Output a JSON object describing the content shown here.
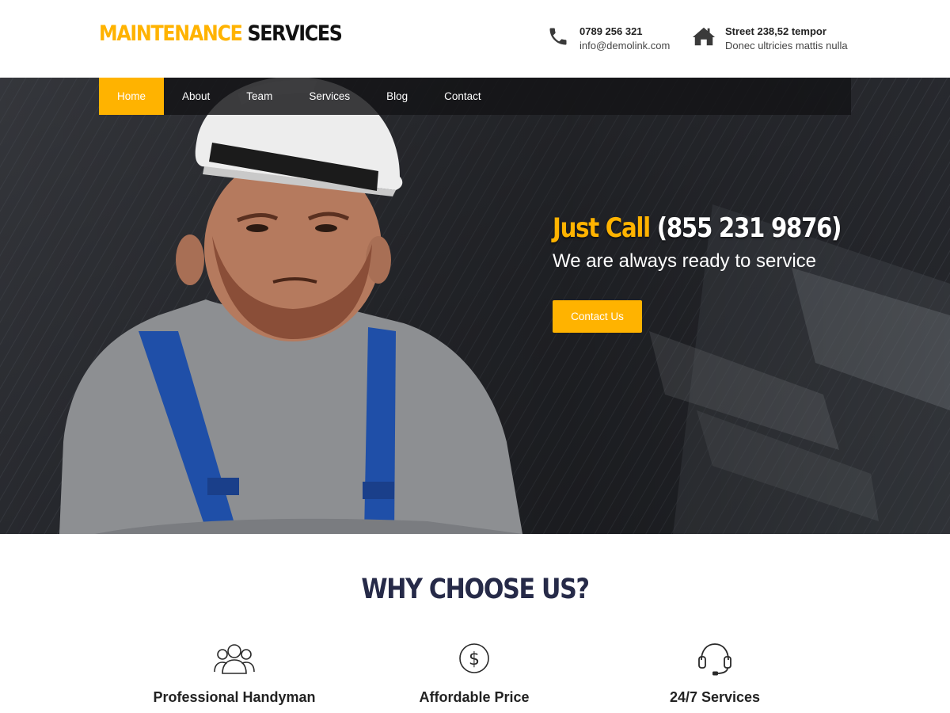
{
  "header": {
    "logo_part1": "MAINTENANCE",
    "logo_part2": "SERVICES",
    "phone": "0789 256 321",
    "email": "info@demolink.com",
    "address_line1": "Street 238,52 tempor",
    "address_line2": "Donec ultricies mattis nulla",
    "phone_icon": "phone-icon",
    "address_icon": "home-icon"
  },
  "nav": {
    "items": [
      {
        "label": "Home",
        "active": true
      },
      {
        "label": "About"
      },
      {
        "label": "Team"
      },
      {
        "label": "Services"
      },
      {
        "label": "Blog"
      },
      {
        "label": "Contact"
      }
    ]
  },
  "hero": {
    "title_highlight": "Just Call",
    "title_phone": "(855 231 9876)",
    "subtitle": "We are always ready to service",
    "button_label": "Contact Us"
  },
  "why": {
    "title": "WHY CHOOSE US?",
    "features": [
      {
        "label": "Professional Handyman",
        "icon": "users-icon"
      },
      {
        "label": "Affordable Price",
        "icon": "dollar-icon"
      },
      {
        "label": "24/7 Services",
        "icon": "headset-icon"
      }
    ]
  },
  "colors": {
    "accent": "#ffb300",
    "heading": "#262a48",
    "nav_bg": "#141416"
  }
}
